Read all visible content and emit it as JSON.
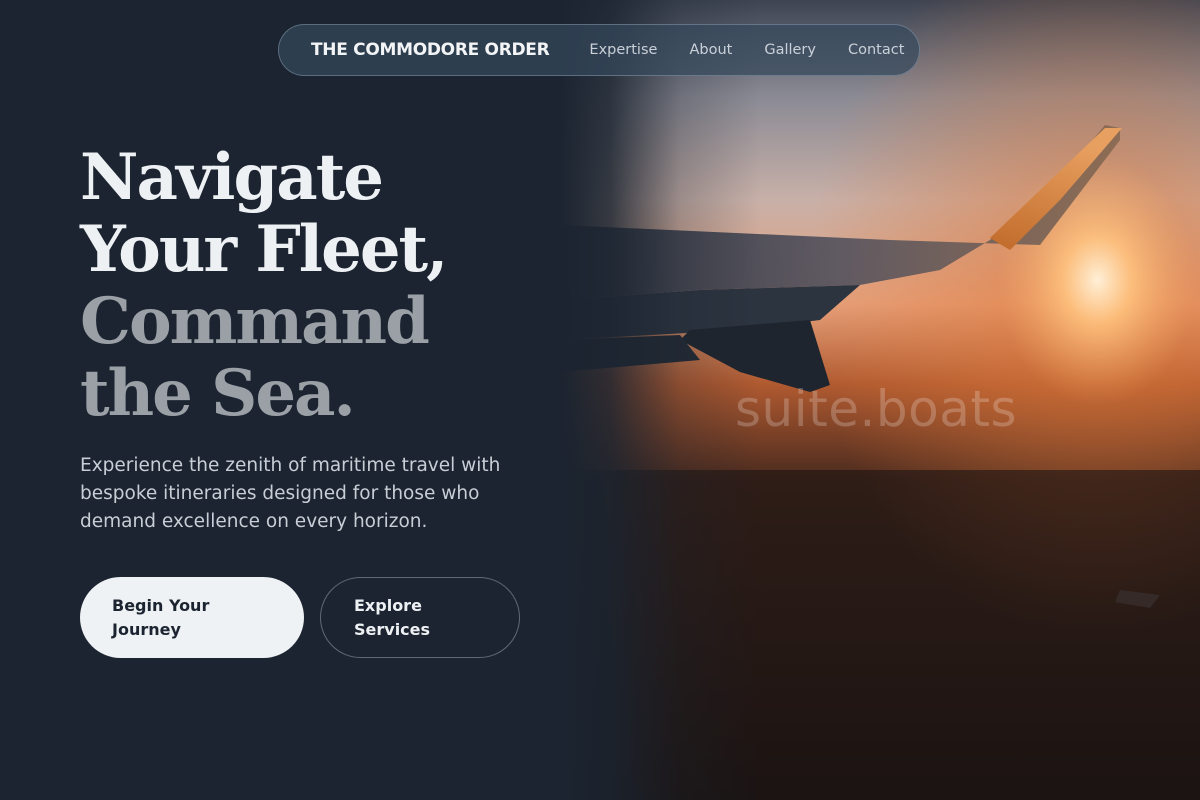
{
  "nav": {
    "brand": "THE COMMODORE ORDER",
    "links": [
      "Expertise",
      "About",
      "Gallery",
      "Contact"
    ]
  },
  "hero": {
    "headline": [
      "Navigate",
      "Your Fleet,",
      "Command",
      "the Sea."
    ],
    "intro": "Experience the zenith of maritime travel with bespoke itineraries designed for those who demand excellence on every horizon.",
    "primary_cta": "Begin Your Journey",
    "secondary_cta": "Explore Services",
    "watermark": "suite.boats"
  },
  "colors": {
    "background": "#1b2430",
    "headline_bright": "#eef1f4",
    "headline_dim": "#9aa0a6",
    "primary_button": "#eef2f4",
    "sunset_glow": "#ff9a3c"
  },
  "icons": [
    "airplane-wing-photo"
  ]
}
